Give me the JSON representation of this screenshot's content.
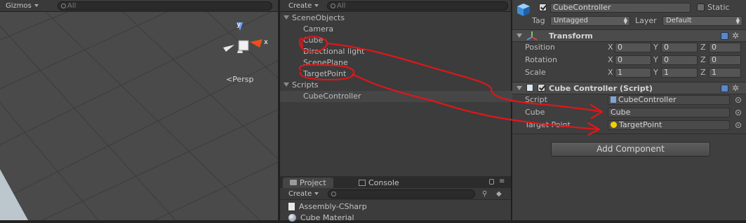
{
  "scene": {
    "gizmos_label": "Gizmos",
    "search_placeholder": "All",
    "persp_label": "Persp",
    "axis_labels": {
      "y": "y",
      "x": "x"
    }
  },
  "hierarchy": {
    "create_label": "Create",
    "search_placeholder": "All",
    "items": [
      {
        "label": "SceneObjects"
      },
      {
        "label": "Camera"
      },
      {
        "label": "Cube"
      },
      {
        "label": "Directional light"
      },
      {
        "label": "ScenePlane"
      },
      {
        "label": "TargetPoint"
      },
      {
        "label": "Scripts"
      },
      {
        "label": "CubeController"
      }
    ]
  },
  "project": {
    "tabs": [
      {
        "label": "Project"
      },
      {
        "label": "Console"
      }
    ],
    "create_label": "Create",
    "items": [
      {
        "label": "Assembly-CSharp"
      },
      {
        "label": "Cube Material"
      }
    ]
  },
  "inspector": {
    "object_name": "CubeController",
    "static_label": "Static",
    "tag_label": "Tag",
    "tag_value": "Untagged",
    "layer_label": "Layer",
    "layer_value": "Default",
    "transform": {
      "title": "Transform",
      "position_label": "Position",
      "rotation_label": "Rotation",
      "scale_label": "Scale",
      "axis": {
        "x": "X",
        "y": "Y",
        "z": "Z"
      },
      "position": {
        "x": "0",
        "y": "0",
        "z": "0"
      },
      "rotation": {
        "x": "0",
        "y": "0",
        "z": "0"
      },
      "scale": {
        "x": "1",
        "y": "1",
        "z": "1"
      }
    },
    "script_component": {
      "title": "Cube Controller (Script)",
      "script_label": "Script",
      "script_value": "CubeController",
      "cube_label": "Cube",
      "cube_value": "Cube",
      "target_label": "Target Point",
      "target_value": "TargetPoint"
    },
    "add_component_label": "Add Component"
  },
  "colors": {
    "annotation": "#e0161a",
    "panel_bg": "#3c3c3c",
    "scene_bg": "#4a4a4a",
    "selection": "#464646"
  }
}
